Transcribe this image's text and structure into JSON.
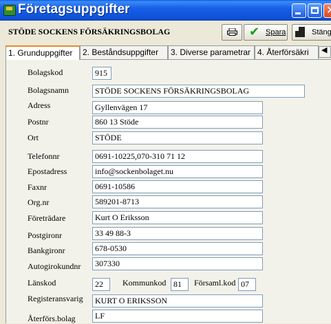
{
  "window": {
    "title": "Företagsuppgifter"
  },
  "toolbar": {
    "company_name": "STÖDE SOCKENS FÖRSÄKRINGSBOLAG",
    "save_label": "Spara",
    "close_label": "Stäng"
  },
  "tabs": [
    {
      "label": "1. Grunduppgifter",
      "active": true
    },
    {
      "label": "2. Beståndsuppgifter",
      "active": false
    },
    {
      "label": "3. Diverse parametrar",
      "active": false
    },
    {
      "label": "4. Återförsäkri",
      "active": false
    }
  ],
  "form": {
    "bolagskod": {
      "label": "Bolagskod",
      "value": "915"
    },
    "bolagsnamn": {
      "label": "Bolagsnamn",
      "value": "STÖDE SOCKENS FÖRSÄKRINGSBOLAG"
    },
    "adress": {
      "label": "Adress",
      "value": "Gyllenvägen 17"
    },
    "postnr": {
      "label": "Postnr",
      "value": "860 13 Stöde"
    },
    "ort": {
      "label": "Ort",
      "value": "STÖDE"
    },
    "telefonnr": {
      "label": "Telefonnr",
      "value": "0691-10225,070-310 71 12"
    },
    "epostadress": {
      "label": "Epostadress",
      "value": "info@sockenbolaget.nu"
    },
    "faxnr": {
      "label": "Faxnr",
      "value": "0691-10586"
    },
    "orgnr": {
      "label": "Org.nr",
      "value": "589201-8713"
    },
    "foretradare": {
      "label": "Företrädare",
      "value": "Kurt O Eriksson"
    },
    "postgironr": {
      "label": "Postgironr",
      "value": "33 49 88-3"
    },
    "bankgironr": {
      "label": "Bankgironr",
      "value": "678-0530"
    },
    "autogirokundnr": {
      "label": "Autogirokundnr",
      "value": "307330"
    },
    "lanskod": {
      "label": "Länskod",
      "value": "22"
    },
    "kommunkod": {
      "label": "Kommunkod",
      "value": "81"
    },
    "forsamlkod": {
      "label": "Församl.kod",
      "value": "07"
    },
    "registeransvarig": {
      "label": "Registeransvarig",
      "value": "KURT O ERIKSSON"
    },
    "aterforsbolag": {
      "label": "Återförs.bolag",
      "value": "LF"
    }
  }
}
